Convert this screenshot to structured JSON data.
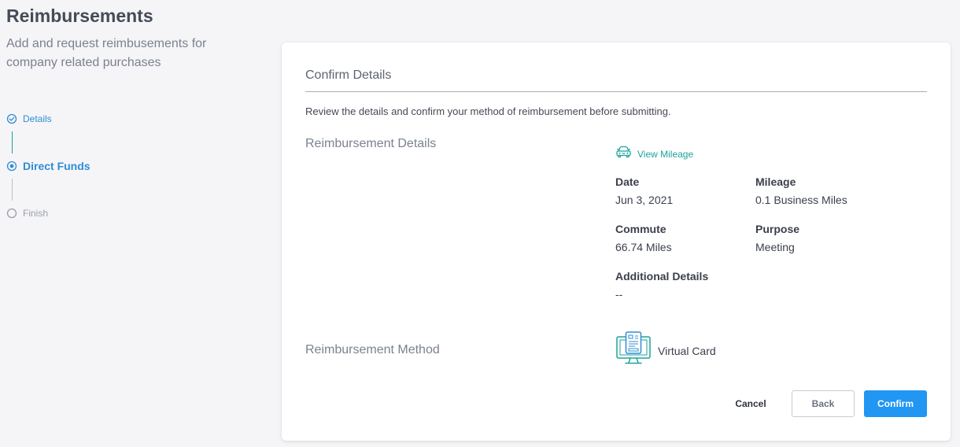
{
  "page": {
    "title": "Reimbursements",
    "subtitle": "Add and request reimbusements for company related purchases"
  },
  "stepper": {
    "steps": [
      {
        "label": "Details",
        "state": "done",
        "icon": "check-circle-icon"
      },
      {
        "label": "Direct Funds",
        "state": "active",
        "icon": "radio-dot-icon"
      },
      {
        "label": "Finish",
        "state": "pending",
        "icon": "empty-circle-icon"
      }
    ]
  },
  "confirm": {
    "title": "Confirm Details",
    "description": "Review the details and confirm your method of reimbursement before submitting.",
    "details_section_label": "Reimbursement Details",
    "view_mileage_label": "View Mileage",
    "view_mileage_icon": "car-icon",
    "fields": {
      "date": {
        "label": "Date",
        "value": "Jun 3, 2021"
      },
      "mileage": {
        "label": "Mileage",
        "value": "0.1 Business Miles"
      },
      "commute": {
        "label": "Commute",
        "value": "66.74 Miles"
      },
      "purpose": {
        "label": "Purpose",
        "value": "Meeting"
      },
      "additional": {
        "label": "Additional Details",
        "value": "--"
      }
    },
    "method_section_label": "Reimbursement Method",
    "method": {
      "label": "Virtual Card",
      "icon": "virtual-card-monitor-icon"
    }
  },
  "actions": {
    "cancel": "Cancel",
    "back": "Back",
    "confirm": "Confirm"
  },
  "colors": {
    "accent_blue": "#2196f3",
    "step_blue": "#2f8dd6",
    "accent_teal": "#1ba39c",
    "background": "#f5f5f7",
    "card": "#ffffff"
  }
}
